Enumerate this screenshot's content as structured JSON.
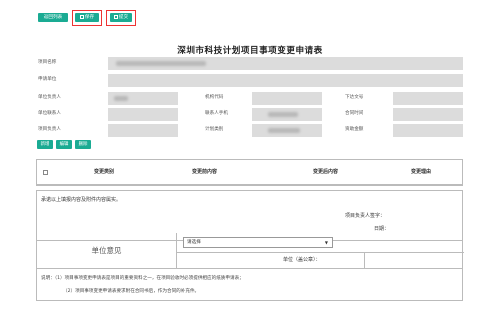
{
  "toolbar": {
    "back_label": "返回列表",
    "save_label": "保存",
    "submit_label": "提交",
    "accent_color": "#1aab93",
    "highlight_color": "#e33333"
  },
  "form": {
    "title": "深圳市科技计划项目事项变更申请表",
    "labels": {
      "project_name": "项目名称",
      "applicant_unit": "申请单位",
      "unit_leader": "单位负责人",
      "org_code": "机构代码",
      "issue_number": "下达文号",
      "unit_contact": "单位联系人",
      "contact_phone": "联系人手机",
      "contract_date": "合同时间",
      "project_leader": "项目负责人",
      "plan_category": "计划类别",
      "funding_amount": "资助金额"
    }
  },
  "actions": {
    "add_label": "新增",
    "edit_label": "编辑",
    "delete_label": "删除"
  },
  "change_table": {
    "columns": [
      "变更类别",
      "变更前内容",
      "变更后内容",
      "变更理由"
    ]
  },
  "declaration": {
    "text": "承诺以上填报内容及附件内容属实。",
    "leader_sign": "项目负责人签字：",
    "date_label": "日期："
  },
  "unit_opinion": {
    "label": "单位意见",
    "select_value": "请选择",
    "seal_label": "单位（盖公章）："
  },
  "notes": {
    "line1": "说明：（1）项目事项变更申请表是项目的重要资料之一，在项目验收时必须提供相应的纸质申请表；",
    "line2": "（2）项目事项变更申请表要求附在合同书后，作为合同的补充件。"
  }
}
